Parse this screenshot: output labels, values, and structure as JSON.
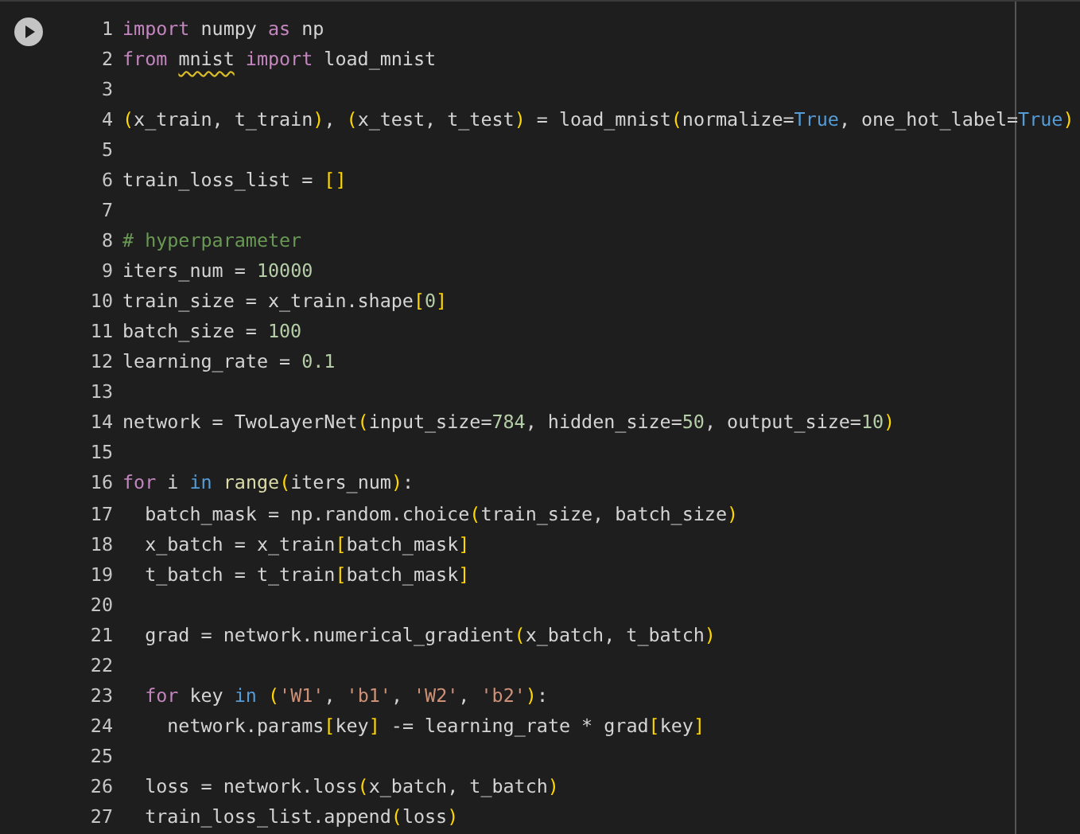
{
  "code_lines": [
    {
      "number": "1",
      "tokens": [
        {
          "kind": "keyword",
          "text": "import"
        },
        {
          "kind": "plain",
          "text": " numpy "
        },
        {
          "kind": "keyword",
          "text": "as"
        },
        {
          "kind": "plain",
          "text": " np"
        }
      ]
    },
    {
      "number": "2",
      "tokens": [
        {
          "kind": "keyword",
          "text": "from "
        },
        {
          "kind": "warning",
          "text": "mnist"
        },
        {
          "kind": "keyword",
          "text": " import"
        },
        {
          "kind": "plain",
          "text": " load_mnist"
        }
      ]
    },
    {
      "number": "3"
    },
    {
      "number": "4",
      "tokens": [
        {
          "kind": "bracket",
          "text": "("
        },
        {
          "kind": "plain",
          "text": "x_train, t_train"
        },
        {
          "kind": "bracket",
          "text": ")"
        },
        {
          "kind": "plain",
          "text": ", "
        },
        {
          "kind": "bracket",
          "text": "("
        },
        {
          "kind": "plain",
          "text": "x_test, t_test"
        },
        {
          "kind": "bracket",
          "text": ")"
        },
        {
          "kind": "plain",
          "text": " = load_mnist"
        },
        {
          "kind": "bracket",
          "text": "("
        },
        {
          "kind": "plain",
          "text": "normalize="
        },
        {
          "kind": "constant",
          "text": "True"
        },
        {
          "kind": "plain",
          "text": ", one_hot_label="
        },
        {
          "kind": "constant",
          "text": "True"
        },
        {
          "kind": "bracket",
          "text": ")"
        }
      ]
    },
    {
      "number": "5"
    },
    {
      "number": "6",
      "tokens": [
        {
          "kind": "plain",
          "text": "train_loss_list = "
        },
        {
          "kind": "bracket",
          "text": "[]"
        }
      ]
    },
    {
      "number": "7"
    },
    {
      "number": "8",
      "tokens": [
        {
          "kind": "comment",
          "text": "# hyperparameter"
        }
      ]
    },
    {
      "number": "9",
      "tokens": [
        {
          "kind": "plain",
          "text": "iters_num = "
        },
        {
          "kind": "number",
          "text": "10000"
        }
      ]
    },
    {
      "number": "10",
      "tokens": [
        {
          "kind": "plain",
          "text": "train_size = x_train.shape"
        },
        {
          "kind": "bracket",
          "text": "["
        },
        {
          "kind": "number",
          "text": "0"
        },
        {
          "kind": "bracket",
          "text": "]"
        }
      ]
    },
    {
      "number": "11",
      "tokens": [
        {
          "kind": "plain",
          "text": "batch_size = "
        },
        {
          "kind": "number",
          "text": "100"
        }
      ]
    },
    {
      "number": "12",
      "tokens": [
        {
          "kind": "plain",
          "text": "learning_rate = "
        },
        {
          "kind": "number",
          "text": "0.1"
        }
      ]
    },
    {
      "number": "13"
    },
    {
      "number": "14",
      "tokens": [
        {
          "kind": "plain",
          "text": "network = TwoLayerNet"
        },
        {
          "kind": "bracket",
          "text": "("
        },
        {
          "kind": "plain",
          "text": "input_size="
        },
        {
          "kind": "number",
          "text": "784"
        },
        {
          "kind": "plain",
          "text": ", hidden_size="
        },
        {
          "kind": "number",
          "text": "50"
        },
        {
          "kind": "plain",
          "text": ", output_size="
        },
        {
          "kind": "number",
          "text": "10"
        },
        {
          "kind": "bracket",
          "text": ")"
        }
      ]
    },
    {
      "number": "15"
    },
    {
      "number": "16",
      "tokens": [
        {
          "kind": "keyword",
          "text": "for"
        },
        {
          "kind": "plain",
          "text": " i "
        },
        {
          "kind": "constant",
          "text": "in "
        },
        {
          "kind": "function",
          "text": "range"
        },
        {
          "kind": "bracket",
          "text": "("
        },
        {
          "kind": "plain",
          "text": "iters_num"
        },
        {
          "kind": "bracket",
          "text": ")"
        },
        {
          "kind": "plain",
          "text": ":"
        }
      ]
    },
    {
      "number": "17",
      "tokens": [
        {
          "kind": "plain",
          "text": "  batch_mask = np.random.choice"
        },
        {
          "kind": "bracket",
          "text": "("
        },
        {
          "kind": "plain",
          "text": "train_size, batch_size"
        },
        {
          "kind": "bracket",
          "text": ")"
        }
      ]
    },
    {
      "number": "18",
      "tokens": [
        {
          "kind": "plain",
          "text": "  x_batch = x_train"
        },
        {
          "kind": "bracket",
          "text": "["
        },
        {
          "kind": "plain",
          "text": "batch_mask"
        },
        {
          "kind": "bracket",
          "text": "]"
        }
      ]
    },
    {
      "number": "19",
      "tokens": [
        {
          "kind": "plain",
          "text": "  t_batch = t_train"
        },
        {
          "kind": "bracket",
          "text": "["
        },
        {
          "kind": "plain",
          "text": "batch_mask"
        },
        {
          "kind": "bracket",
          "text": "]"
        }
      ]
    },
    {
      "number": "20"
    },
    {
      "number": "21",
      "tokens": [
        {
          "kind": "plain",
          "text": "  grad = network.numerical_gradient"
        },
        {
          "kind": "bracket",
          "text": "("
        },
        {
          "kind": "plain",
          "text": "x_batch, t_batch"
        },
        {
          "kind": "bracket",
          "text": ")"
        }
      ]
    },
    {
      "number": "22"
    },
    {
      "number": "23",
      "tokens": [
        {
          "kind": "keyword",
          "text": "  for"
        },
        {
          "kind": "plain",
          "text": " key "
        },
        {
          "kind": "constant",
          "text": "in "
        },
        {
          "kind": "bracket",
          "text": "("
        },
        {
          "kind": "string",
          "text": "'W1'"
        },
        {
          "kind": "plain",
          "text": ", "
        },
        {
          "kind": "string",
          "text": "'b1'"
        },
        {
          "kind": "plain",
          "text": ", "
        },
        {
          "kind": "string",
          "text": "'W2'"
        },
        {
          "kind": "plain",
          "text": ", "
        },
        {
          "kind": "string",
          "text": "'b2'"
        },
        {
          "kind": "bracket",
          "text": ")"
        },
        {
          "kind": "plain",
          "text": ":"
        }
      ]
    },
    {
      "number": "24",
      "tokens": [
        {
          "kind": "plain",
          "text": "    network.params"
        },
        {
          "kind": "bracket",
          "text": "["
        },
        {
          "kind": "plain",
          "text": "key"
        },
        {
          "kind": "bracket",
          "text": "]"
        },
        {
          "kind": "plain",
          "text": " -= learning_rate * grad"
        },
        {
          "kind": "bracket",
          "text": "["
        },
        {
          "kind": "plain",
          "text": "key"
        },
        {
          "kind": "bracket",
          "text": "]"
        }
      ]
    },
    {
      "number": "25"
    },
    {
      "number": "26",
      "tokens": [
        {
          "kind": "plain",
          "text": "  loss = network.loss"
        },
        {
          "kind": "bracket",
          "text": "("
        },
        {
          "kind": "plain",
          "text": "x_batch, t_batch"
        },
        {
          "kind": "bracket",
          "text": ")"
        }
      ]
    },
    {
      "number": "27",
      "tokens": [
        {
          "kind": "plain",
          "text": "  train_loss_list.append"
        },
        {
          "kind": "bracket",
          "text": "("
        },
        {
          "kind": "plain",
          "text": "loss"
        },
        {
          "kind": "bracket",
          "text": ")"
        }
      ]
    }
  ]
}
